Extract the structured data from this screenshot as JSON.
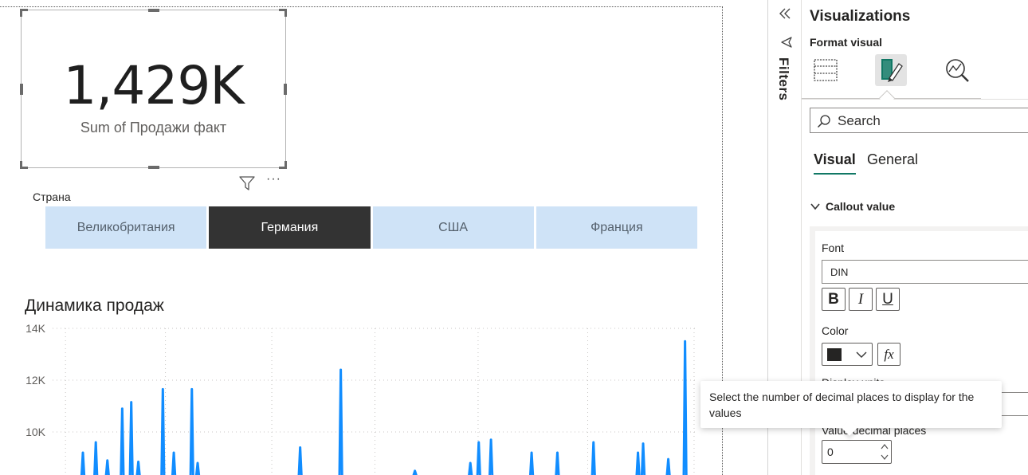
{
  "card": {
    "value": "1,429K",
    "label": "Sum of Продажи факт",
    "more_label": "···"
  },
  "slicer": {
    "title": "Страна",
    "items": [
      {
        "label": "Великобритания",
        "selected": false
      },
      {
        "label": "Германия",
        "selected": true
      },
      {
        "label": "США",
        "selected": false
      },
      {
        "label": "Франция",
        "selected": false
      }
    ]
  },
  "chart": {
    "title": "Динамика продаж",
    "y_ticks": [
      "14K",
      "12K",
      "10K"
    ]
  },
  "chart_data": {
    "type": "line",
    "title": "Динамика продаж",
    "ylim_visible": [
      8400,
      14000
    ],
    "y_ticks": [
      10000,
      12000,
      14000
    ],
    "series": [
      {
        "color": "#118DFF",
        "spikes": [
          {
            "x": 0.047,
            "y": 9200
          },
          {
            "x": 0.067,
            "y": 9600
          },
          {
            "x": 0.085,
            "y": 8900
          },
          {
            "x": 0.108,
            "y": 10900
          },
          {
            "x": 0.122,
            "y": 11150
          },
          {
            "x": 0.133,
            "y": 8850
          },
          {
            "x": 0.171,
            "y": 11650
          },
          {
            "x": 0.188,
            "y": 9200
          },
          {
            "x": 0.216,
            "y": 11650
          },
          {
            "x": 0.225,
            "y": 8800
          },
          {
            "x": 0.384,
            "y": 9400
          },
          {
            "x": 0.447,
            "y": 12400
          },
          {
            "x": 0.562,
            "y": 8500
          },
          {
            "x": 0.648,
            "y": 8800
          },
          {
            "x": 0.661,
            "y": 9600
          },
          {
            "x": 0.68,
            "y": 9700
          },
          {
            "x": 0.743,
            "y": 9200
          },
          {
            "x": 0.783,
            "y": 9200
          },
          {
            "x": 0.839,
            "y": 9600
          },
          {
            "x": 0.908,
            "y": 9200
          },
          {
            "x": 0.916,
            "y": 9550
          },
          {
            "x": 0.955,
            "y": 8950
          },
          {
            "x": 0.981,
            "y": 13500
          }
        ]
      }
    ]
  },
  "filters_pane": {
    "label": "Filters"
  },
  "viz_pane": {
    "title": "Visualizations",
    "subtitle": "Format visual",
    "search_placeholder": "Search",
    "subtabs": {
      "visual": "Visual",
      "general": "General"
    },
    "section_title": "Callout value",
    "font_label": "Font",
    "font_value": "DIN",
    "bold_label": "B",
    "italic_label": "I",
    "underline_label": "U",
    "color_label": "Color",
    "color_value": "#252423",
    "fx_label": "fx",
    "display_units_label": "Display units",
    "decimal_label": "Value decimal places",
    "decimal_value": "0"
  },
  "tooltip": {
    "text": "Select the number of decimal places to display for the values"
  },
  "colors": {
    "accent": "#117865",
    "slicer_selected": "#333333",
    "slicer_default": "#cfe3f7",
    "series": "#118DFF"
  }
}
